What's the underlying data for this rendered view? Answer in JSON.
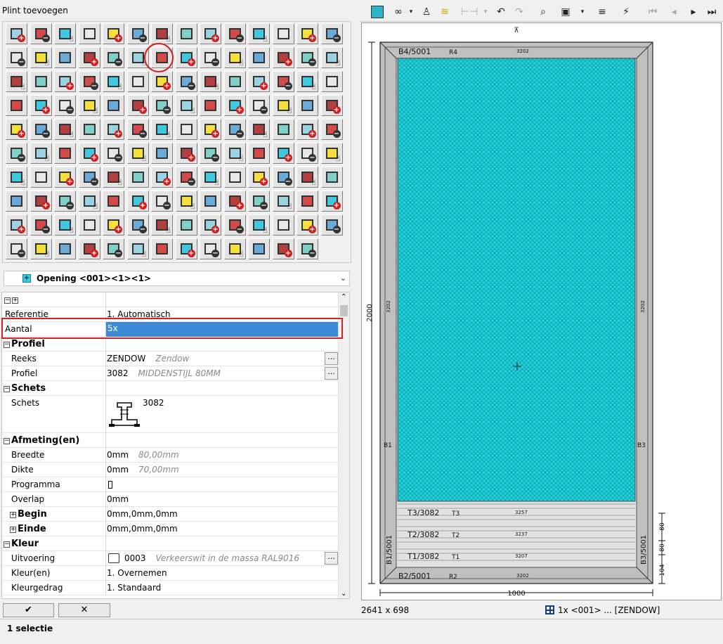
{
  "left_panel": {
    "title": "Plint toevoegen"
  },
  "selector": {
    "label": "Opening <001><1><1>",
    "icon": "opening-icon"
  },
  "properties": {
    "header_icons": [
      "collapse-all-icon",
      "expand-all-icon"
    ],
    "referentie": {
      "label": "Referentie",
      "value": "1. Automatisch"
    },
    "aantal": {
      "label": "Aantal",
      "value": "5x"
    },
    "profiel_section": "Profiel",
    "reeks": {
      "label": "Reeks",
      "value": "ZENDOW",
      "desc": "Zendow"
    },
    "profiel": {
      "label": "Profiel",
      "value": "3082",
      "desc": "MIDDENSTIJL 80MM"
    },
    "schets_section": "Schets",
    "schets": {
      "label": "Schets",
      "value": "3082"
    },
    "afmeting_section": "Afmeting(en)",
    "breedte": {
      "label": "Breedte",
      "value": "0mm",
      "desc": "80,00mm"
    },
    "dikte": {
      "label": "Dikte",
      "value": "0mm",
      "desc": "70,00mm"
    },
    "programma": {
      "label": "Programma",
      "value": ""
    },
    "overlap": {
      "label": "Overlap",
      "value": "0mm"
    },
    "begin": {
      "label": "Begin",
      "value": "0mm,0mm,0mm"
    },
    "einde": {
      "label": "Einde",
      "value": "0mm,0mm,0mm"
    },
    "kleur_section": "Kleur",
    "uitvoering": {
      "label": "Uitvoering",
      "value": "0003",
      "desc": "Verkeerswit in de massa RAL9016"
    },
    "kleuren": {
      "label": "Kleur(en)",
      "value": "1. Overnemen"
    },
    "kleurgedrag": {
      "label": "Kleurgedrag",
      "value": "1. Standaard"
    },
    "ellipsis": "..."
  },
  "buttons": {
    "ok": "✔",
    "cancel": "✕"
  },
  "status": {
    "selection": "1 selectie"
  },
  "drawing": {
    "top_marker": "⊼",
    "b4": "B4/5001",
    "r4": "R4",
    "r4_code": "3202",
    "b2": "B2/5001",
    "r2": "R2",
    "r2_code": "3202",
    "b1": "B1",
    "b3": "B3",
    "b1_5001": "B1/5001",
    "b3_5001": "B3/5001",
    "side_code": "3202",
    "t3": "T3/3082",
    "t3r": "T3",
    "t3_code": "3257",
    "t2": "T2/3082",
    "t2r": "T2",
    "t2_code": "3237",
    "t1": "T1/3082",
    "t1r": "T1",
    "t1_code": "3207",
    "height": "2000",
    "width": "1000",
    "dim_104": "104",
    "dim_80a": "80",
    "dim_80b": "80",
    "canvas_size": "2641 x 698",
    "summary": "1x <001> ... [ZENDOW]",
    "glass_color": "#22d0d8",
    "frame_color": "#c0c0c0"
  }
}
